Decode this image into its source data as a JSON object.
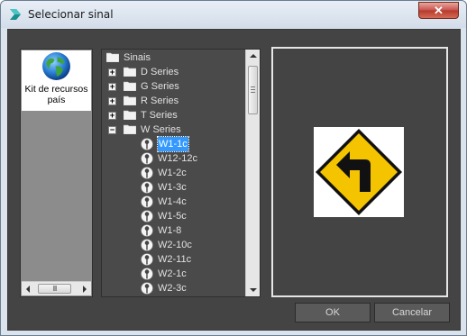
{
  "window": {
    "title": "Selecionar sinal",
    "close_label": "✕"
  },
  "library_panel": {
    "item_label": "Kit de recursos país",
    "item_icon": "globe-icon",
    "scroll_thumb": "III"
  },
  "tree": {
    "items": [
      {
        "label": "Sinais",
        "level": 0,
        "icon": "folder-icon",
        "expander": ""
      },
      {
        "label": "D Series",
        "level": 1,
        "icon": "folder-icon",
        "expander": "+"
      },
      {
        "label": "G Series",
        "level": 1,
        "icon": "folder-icon",
        "expander": "+"
      },
      {
        "label": "R Series",
        "level": 1,
        "icon": "folder-icon",
        "expander": "+"
      },
      {
        "label": "T Series",
        "level": 1,
        "icon": "folder-icon",
        "expander": "+"
      },
      {
        "label": "W Series",
        "level": 1,
        "icon": "folder-icon",
        "expander": "−"
      },
      {
        "label": "W1-1c",
        "level": 2,
        "icon": "sign-icon",
        "selected": true
      },
      {
        "label": "W12-12c",
        "level": 2,
        "icon": "sign-icon"
      },
      {
        "label": "W1-2c",
        "level": 2,
        "icon": "sign-icon"
      },
      {
        "label": "W1-3c",
        "level": 2,
        "icon": "sign-icon"
      },
      {
        "label": "W1-4c",
        "level": 2,
        "icon": "sign-icon"
      },
      {
        "label": "W1-5c",
        "level": 2,
        "icon": "sign-icon"
      },
      {
        "label": "W1-8",
        "level": 2,
        "icon": "sign-icon"
      },
      {
        "label": "W2-10c",
        "level": 2,
        "icon": "sign-icon"
      },
      {
        "label": "W2-11c",
        "level": 2,
        "icon": "sign-icon"
      },
      {
        "label": "W2-1c",
        "level": 2,
        "icon": "sign-icon"
      },
      {
        "label": "W2-3c",
        "level": 2,
        "icon": "sign-icon"
      }
    ]
  },
  "preview": {
    "sign": "left-turn-warning-sign",
    "sign_color": "#f5c400"
  },
  "buttons": {
    "ok": "OK",
    "cancel": "Cancelar"
  },
  "colors": {
    "panel_bg": "#444444",
    "selection": "#3399ff"
  }
}
